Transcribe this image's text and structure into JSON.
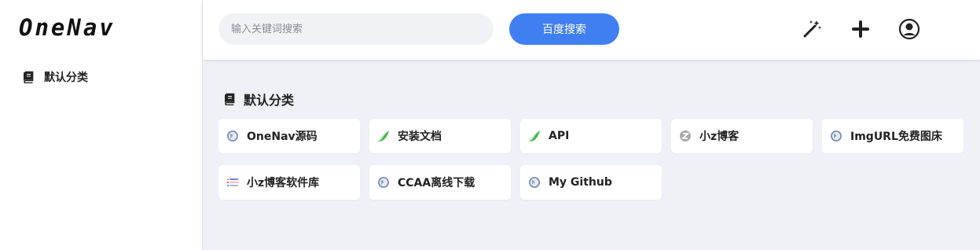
{
  "app": {
    "logo_text": "OneNav"
  },
  "sidebar": {
    "items": [
      {
        "label": "默认分类",
        "icon": "book-icon"
      }
    ]
  },
  "header": {
    "search_placeholder": "输入关键词搜索",
    "search_button": "百度搜索",
    "icons": [
      "magic-wand-icon",
      "plus-icon",
      "user-icon"
    ]
  },
  "main": {
    "section_title": "默认分类",
    "links": [
      {
        "label": "OneNav源码",
        "icon": "globe-icon"
      },
      {
        "label": "安装文档",
        "icon": "leaf-icon"
      },
      {
        "label": "API",
        "icon": "leaf-icon"
      },
      {
        "label": "小z博客",
        "icon": "z-logo-icon"
      },
      {
        "label": "ImgURL免费图床",
        "icon": "globe-icon"
      },
      {
        "label": "小z博客软件库",
        "icon": "list-icon"
      },
      {
        "label": "CCAA离线下载",
        "icon": "globe-icon"
      },
      {
        "label": "My Github",
        "icon": "globe-icon"
      }
    ]
  },
  "colors": {
    "accent": "#3f7ff2",
    "main_bg": "#f0f1f7",
    "leaf_green": "#3cb44a"
  }
}
